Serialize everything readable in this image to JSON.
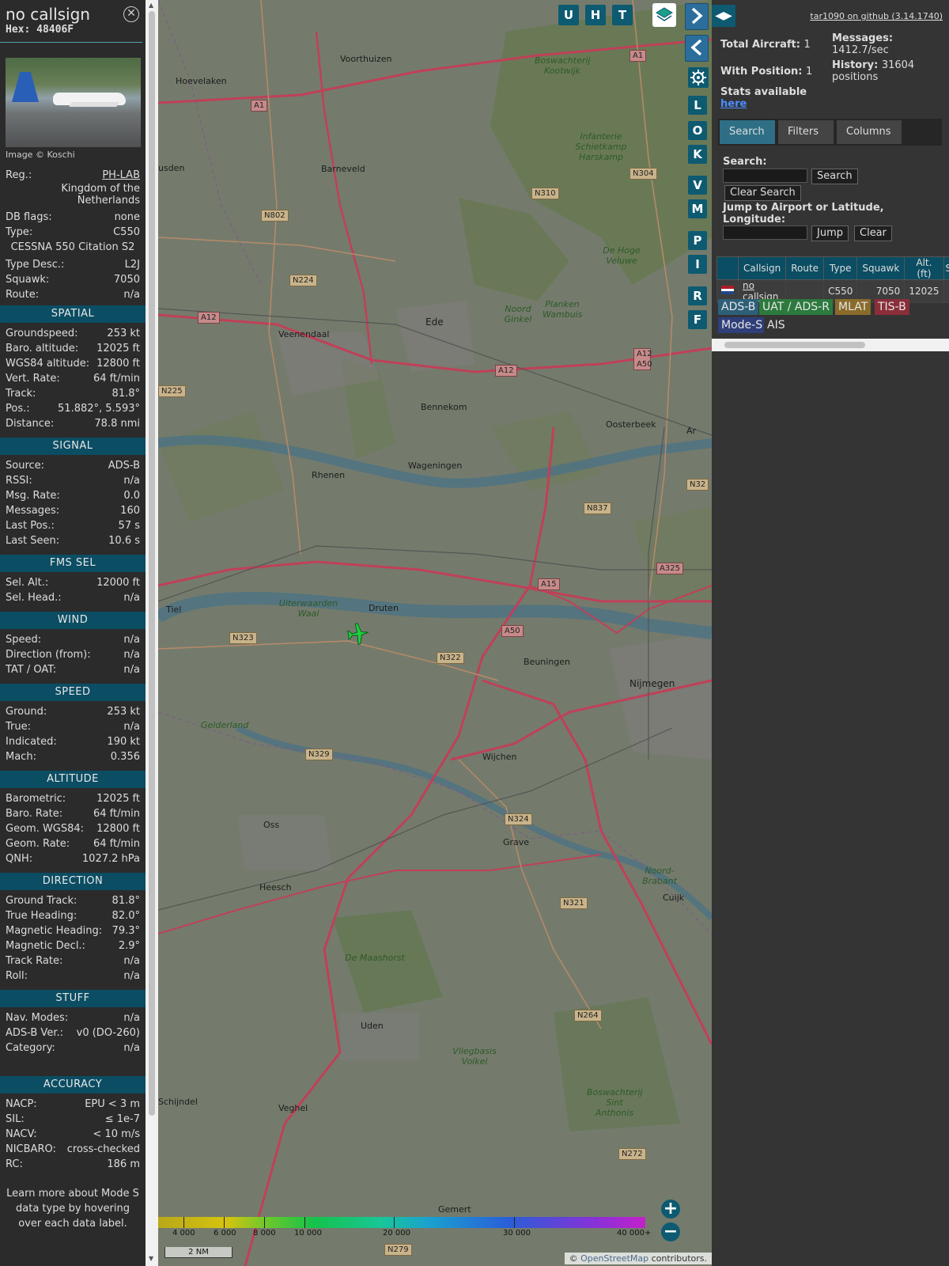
{
  "info": {
    "callsign": "no callsign",
    "hex": "Hex: 48406F",
    "photo_caption": "Image © Koschi",
    "reg_label": "Reg.:",
    "reg_value": "PH-LAB",
    "country": "Kingdom of the Netherlands",
    "db_flags_label": "DB flags:",
    "db_flags_value": "none",
    "type_label": "Type:",
    "type_value": "C550",
    "model": "CESSNA 550 Citation S2",
    "type_desc_label": "Type Desc.:",
    "type_desc_value": "L2J",
    "squawk_label": "Squawk:",
    "squawk_value": "7050",
    "route_label": "Route:",
    "route_value": "n/a",
    "footnote": "Learn more about Mode S data type by hovering over each data label."
  },
  "sections": [
    {
      "title": "SPATIAL",
      "rows": [
        {
          "k": "Groundspeed:",
          "v": "253 kt"
        },
        {
          "k": "Baro. altitude:",
          "v": "12025 ft"
        },
        {
          "k": "WGS84 altitude:",
          "v": "12800 ft"
        },
        {
          "k": "Vert. Rate:",
          "v": "64 ft/min"
        },
        {
          "k": "Track:",
          "v": "81.8°"
        },
        {
          "k": "Pos.:",
          "v": "51.882°, 5.593°"
        },
        {
          "k": "Distance:",
          "v": "78.8 nmi"
        }
      ]
    },
    {
      "title": "SIGNAL",
      "rows": [
        {
          "k": "Source:",
          "v": "ADS-B"
        },
        {
          "k": "RSSI:",
          "v": "n/a"
        },
        {
          "k": "Msg. Rate:",
          "v": "0.0"
        },
        {
          "k": "Messages:",
          "v": "160"
        },
        {
          "k": "Last Pos.:",
          "v": "57 s"
        },
        {
          "k": "Last Seen:",
          "v": "10.6 s"
        }
      ]
    },
    {
      "title": "FMS SEL",
      "rows": [
        {
          "k": "Sel. Alt.:",
          "v": "12000 ft"
        },
        {
          "k": "Sel. Head.:",
          "v": "n/a"
        }
      ]
    },
    {
      "title": "WIND",
      "rows": [
        {
          "k": "Speed:",
          "v": "n/a"
        },
        {
          "k": "Direction (from):",
          "v": "n/a"
        },
        {
          "k": "TAT / OAT:",
          "v": "n/a"
        }
      ]
    },
    {
      "title": "SPEED",
      "rows": [
        {
          "k": "Ground:",
          "v": "253 kt"
        },
        {
          "k": "True:",
          "v": "n/a"
        },
        {
          "k": "Indicated:",
          "v": "190 kt"
        },
        {
          "k": "Mach:",
          "v": "0.356"
        }
      ]
    },
    {
      "title": "ALTITUDE",
      "rows": [
        {
          "k": "Barometric:",
          "v": "12025 ft"
        },
        {
          "k": "Baro. Rate:",
          "v": "64 ft/min"
        },
        {
          "k": "Geom. WGS84:",
          "v": "12800 ft"
        },
        {
          "k": "Geom. Rate:",
          "v": "64 ft/min"
        },
        {
          "k": "QNH:",
          "v": "1027.2 hPa"
        }
      ]
    },
    {
      "title": "DIRECTION",
      "rows": [
        {
          "k": "Ground Track:",
          "v": "81.8°"
        },
        {
          "k": "True Heading:",
          "v": "82.0°"
        },
        {
          "k": "Magnetic Heading:",
          "v": "79.3°"
        },
        {
          "k": "Magnetic Decl.:",
          "v": "2.9°"
        },
        {
          "k": "Track Rate:",
          "v": "n/a"
        },
        {
          "k": "Roll:",
          "v": "n/a"
        }
      ]
    },
    {
      "title": "STUFF",
      "rows": [
        {
          "k": "Nav. Modes:",
          "v": "n/a"
        },
        {
          "k": "ADS-B Ver.:",
          "v": "v0 (DO-260)"
        },
        {
          "k": "Category:",
          "v": "n/a"
        }
      ]
    },
    {
      "title": "ACCURACY",
      "rows": [
        {
          "k": "NACP:",
          "v": "EPU < 3 m"
        },
        {
          "k": "SIL:",
          "v": "≤ 1e-7"
        },
        {
          "k": "NACV:",
          "v": "< 10 m/s"
        },
        {
          "k": "NICBARO:",
          "v": "cross-checked"
        },
        {
          "k": "RC:",
          "v": "186 m"
        }
      ]
    }
  ],
  "map": {
    "top_buttons": [
      "U",
      "H",
      "T"
    ],
    "side_buttons": [
      "L",
      "O",
      "K",
      "V",
      "M",
      "P",
      "I",
      "R",
      "F"
    ],
    "places": [
      {
        "t": "Voorthuizen"
      },
      {
        "t": "Hoevelaken"
      },
      {
        "t": "Barneveld"
      },
      {
        "t": "usden"
      },
      {
        "t": "Ede"
      },
      {
        "t": "Veenendaal"
      },
      {
        "t": "Bennekom"
      },
      {
        "t": "Oosterbeek"
      },
      {
        "t": "Rhenen"
      },
      {
        "t": "Wageningen"
      },
      {
        "t": "Tiel"
      },
      {
        "t": "Druten"
      },
      {
        "t": "Beuningen"
      },
      {
        "t": "Nijmegen"
      },
      {
        "t": "Wijchen"
      },
      {
        "t": "Oss"
      },
      {
        "t": "Grave"
      },
      {
        "t": "Heesch"
      },
      {
        "t": "Cuijk"
      },
      {
        "t": "Uden"
      },
      {
        "t": "Veghel"
      },
      {
        "t": "Schijndel"
      },
      {
        "t": "Gemert"
      },
      {
        "t": "Ar"
      }
    ],
    "areas": [
      {
        "t": "Boswachterij Kootwijk"
      },
      {
        "t": "Infanterie Schietkamp Harskamp"
      },
      {
        "t": "De Hoge Veluwe"
      },
      {
        "t": "Noord Ginkel"
      },
      {
        "t": "Planken Wambuis"
      },
      {
        "t": "Uiterwaarden Waal"
      },
      {
        "t": "De Maashorst"
      },
      {
        "t": "Vliegbasis Volkel"
      },
      {
        "t": "Boswachterij Sint Anthonis"
      },
      {
        "t": "Gelderland"
      },
      {
        "t": "Noord-Brabant"
      }
    ],
    "roads": [
      {
        "t": "A1"
      },
      {
        "t": "A1"
      },
      {
        "t": "N304"
      },
      {
        "t": "N310"
      },
      {
        "t": "N802"
      },
      {
        "t": "N224"
      },
      {
        "t": "A12"
      },
      {
        "t": "A12"
      },
      {
        "t": "A12 A50"
      },
      {
        "t": "N225"
      },
      {
        "t": "N837"
      },
      {
        "t": "A15"
      },
      {
        "t": "A325"
      },
      {
        "t": "N323"
      },
      {
        "t": "N322"
      },
      {
        "t": "A50"
      },
      {
        "t": "N329"
      },
      {
        "t": "N324"
      },
      {
        "t": "N321"
      },
      {
        "t": "N264"
      },
      {
        "t": "N272"
      },
      {
        "t": "N279"
      },
      {
        "t": "N32"
      }
    ],
    "altitude_ticks": [
      "4 000",
      "6 000",
      "8 000",
      "10 000",
      "20 000",
      "30 000",
      "40 000+"
    ],
    "scale": "2 NM",
    "attribution_prefix": "© ",
    "attribution_link": "OpenStreetMap",
    "attribution_suffix": " contributors."
  },
  "sidebar": {
    "version": "tar1090 on github (3.14.1740)",
    "total_aircraft_label": "Total Aircraft:",
    "total_aircraft": "1",
    "with_position_label": "With Position:",
    "with_position": "1",
    "messages_label": "Messages:",
    "messages_rate": "1412.7/sec",
    "history_label": "History:",
    "history_value": "31604",
    "history_unit": "positions",
    "stats_label": "Stats available",
    "stats_link": "here",
    "tabs": [
      "Search",
      "Filters",
      "Columns"
    ],
    "search_label": "Search:",
    "search_button": "Search",
    "clear_search_button": "Clear Search",
    "jump_label": "Jump to Airport or Latitude, Longitude:",
    "jump_button": "Jump",
    "clear_button": "Clear",
    "table_headers": [
      "",
      "Callsign",
      "Route",
      "Type",
      "Squawk",
      "Alt. (ft)",
      "S"
    ],
    "table_rows": [
      {
        "callsign": "no callsign",
        "route": "",
        "type": "C550",
        "squawk": "7050",
        "alt": "12025"
      }
    ],
    "sources": [
      {
        "label": "ADS-B",
        "color": "#2e5f79"
      },
      {
        "label": "UAT / ADS-R",
        "color": "#2c7a3e"
      },
      {
        "label": "MLAT",
        "color": "#8a6b2a"
      },
      {
        "label": "TIS-B",
        "color": "#8a2e3a"
      },
      {
        "label": "Mode-S",
        "color": "#2e3f7a"
      },
      {
        "label": "AIS",
        "color": "#343434"
      }
    ]
  }
}
